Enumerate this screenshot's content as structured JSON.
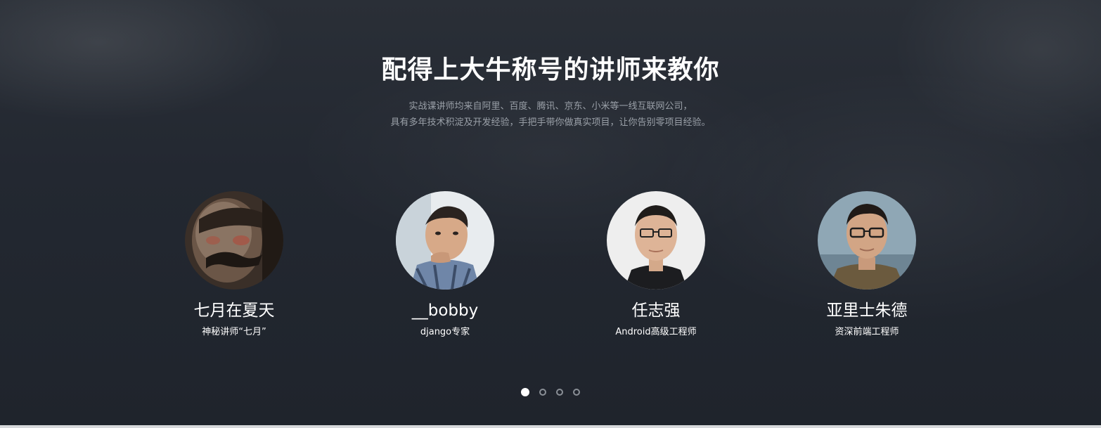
{
  "section": {
    "title": "配得上大牛称号的讲师来教你",
    "subtitle_lines": [
      "实战课讲师均来自阿里、百度、腾讯、京东、小米等一线互联网公司，",
      "具有多年技术积淀及开发经验，手把手带你做真实项目，让你告别零项目经验。"
    ]
  },
  "teachers": [
    {
      "name": "七月在夏天",
      "role": "神秘讲师“七月”",
      "avatar_icon": "masked-man-avatar"
    },
    {
      "name": "__bobby",
      "role": "django专家",
      "avatar_icon": "man-thinking-avatar"
    },
    {
      "name": "任志强",
      "role": "Android高级工程师",
      "avatar_icon": "man-glasses-avatar"
    },
    {
      "name": "亚里士朱德",
      "role": "资深前端工程师",
      "avatar_icon": "man-glasses-outdoor-avatar"
    }
  ],
  "pagination": {
    "active_index": 0,
    "count": 4
  },
  "colors": {
    "background": "#232831",
    "title": "#ffffff",
    "subtitle": "#9aa0a8",
    "dot_active": "#ffffff",
    "dot_inactive": "#8a8f96"
  }
}
